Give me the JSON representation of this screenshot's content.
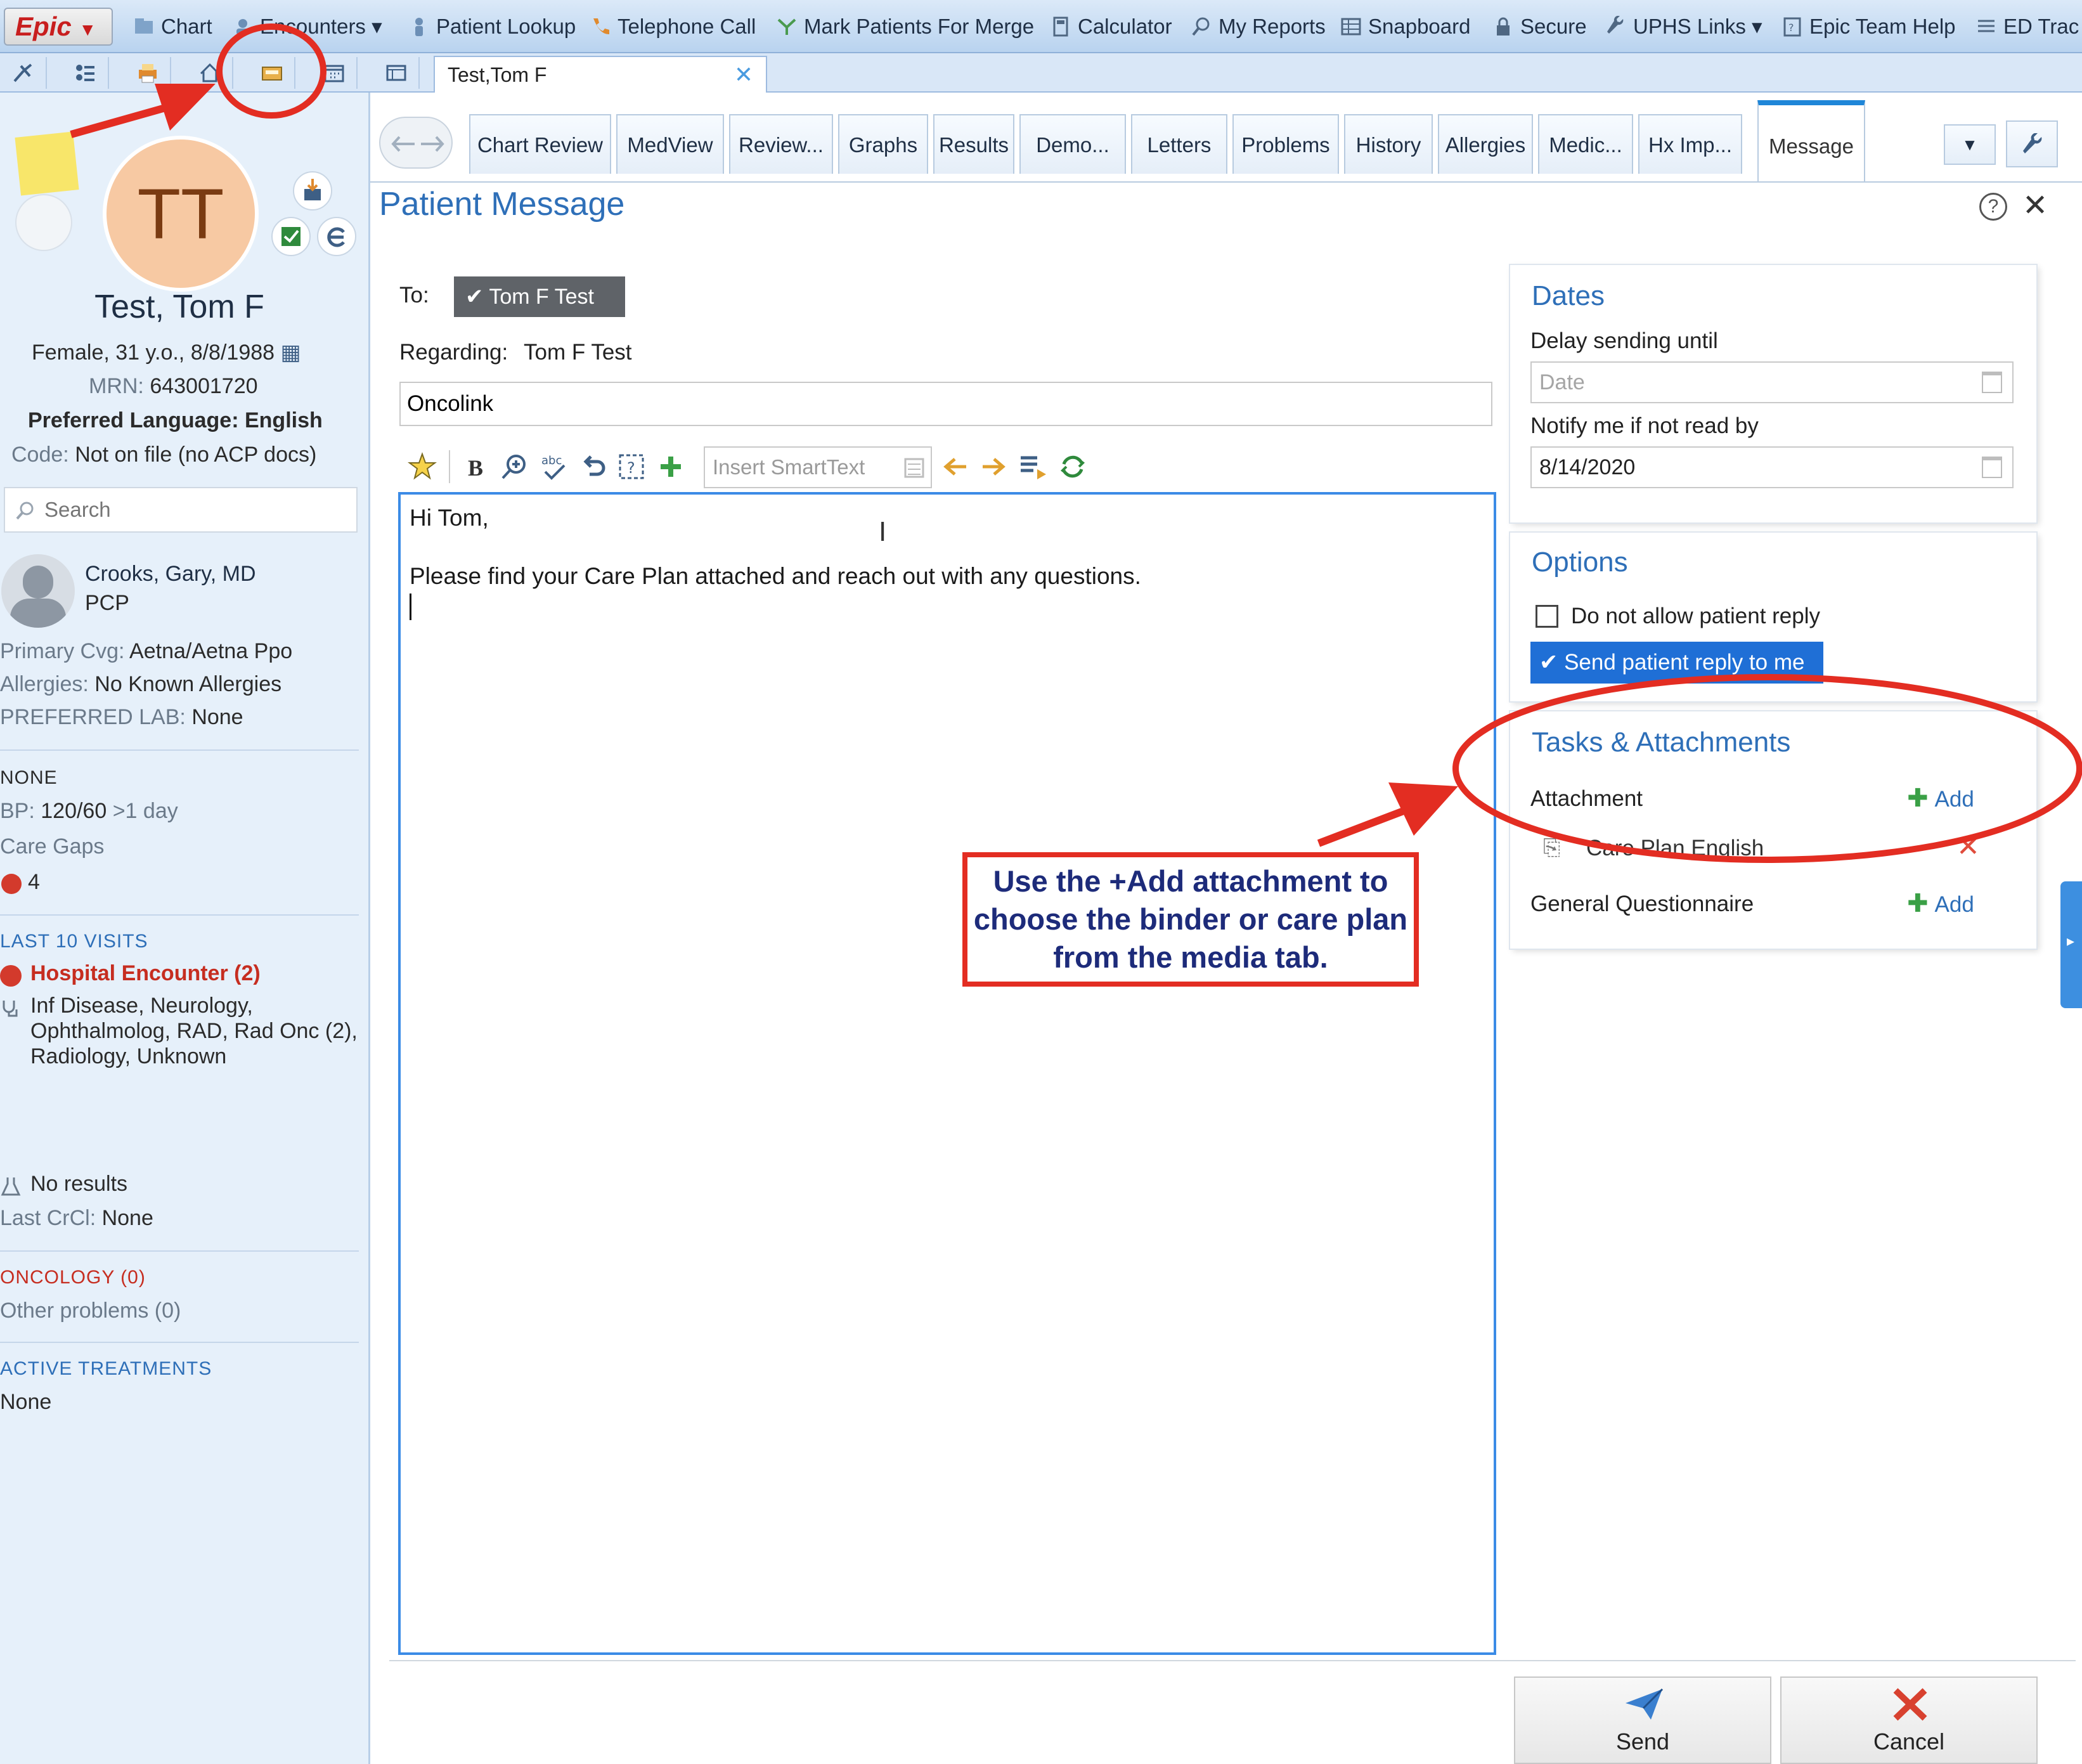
{
  "menubar": {
    "logo": "Epic",
    "items": [
      "Chart",
      "Encounters",
      "Patient Lookup",
      "Telephone Call",
      "Mark Patients For Merge",
      "Calculator",
      "My Reports",
      "Snapboard",
      "Secure",
      "UPHS Links",
      "Epic Team Help",
      "ED Trac"
    ]
  },
  "workspace_tab": {
    "label": "Test,Tom F",
    "close": "✕"
  },
  "patient": {
    "initials": "TT",
    "name": "Test, Tom F",
    "demographics": "Female, 31 y.o., 8/8/1988",
    "mrn_label": "MRN: ",
    "mrn": "643001720",
    "language": "Preferred Language: English",
    "code_label": "Code: ",
    "code": "Not on file (no ACP docs)",
    "search_placeholder": "Search",
    "pcp_name": "Crooks, Gary, MD",
    "pcp_role": "PCP",
    "coverage_label": "Primary Cvg: ",
    "coverage": "Aetna/Aetna Ppo",
    "allergies_label": "Allergies: ",
    "allergies": "No Known Allergies",
    "lab_label": "PREFERRED LAB: ",
    "lab": "None",
    "none_head": "NONE",
    "bp_label": "BP: ",
    "bp": "120/60",
    "bp_age": ">1 day",
    "care_gaps": "Care Gaps",
    "care_gaps_count": "4",
    "visits_head": "LAST 10 VISITS",
    "hospital": "Hospital Encounter (2)",
    "departments": "Inf Disease, Neurology, Ophthalmolog, RAD, Rad Onc (2), Radiology, Unknown",
    "results": "No results",
    "crcl_label": "Last CrCl: ",
    "crcl": "None",
    "oncology_head": "ONCOLOGY (0)",
    "other_problems": "Other problems (0)",
    "treatments_head": "ACTIVE TREATMENTS",
    "treatments": "None"
  },
  "activity_tabs": [
    "Chart Review",
    "MedView",
    "Review...",
    "Graphs",
    "Results",
    "Demo...",
    "Letters",
    "Problems",
    "History",
    "Allergies",
    "Medic...",
    "Hx Imp...",
    "Message"
  ],
  "message": {
    "title": "Patient Message",
    "to_label": "To:",
    "to_value": "Tom F Test",
    "regarding_label": "Regarding:",
    "regarding_value": "Tom F Test",
    "subject": "Oncolink",
    "smarttext_placeholder": "Insert SmartText",
    "body_line1": "Hi Tom,",
    "body_line2": "Please find your Care Plan attached and reach out with any questions."
  },
  "dates": {
    "title": "Dates",
    "delay_label": "Delay sending until",
    "delay_placeholder": "Date",
    "notify_label": "Notify me if not read by",
    "notify_value": "8/14/2020"
  },
  "options": {
    "title": "Options",
    "no_reply_label": "Do not allow patient reply",
    "send_reply_label": "Send patient reply to me"
  },
  "tasks": {
    "title": "Tasks & Attachments",
    "attachment_label": "Attachment",
    "add_label": "Add",
    "attached_file": "Care Plan English",
    "questionnaire_label": "General Questionnaire"
  },
  "annotation": {
    "text": "Use the +Add attachment to choose the binder or care plan from the media tab.",
    "color": "#e32d22"
  },
  "buttons": {
    "send": "Send",
    "cancel": "Cancel"
  }
}
